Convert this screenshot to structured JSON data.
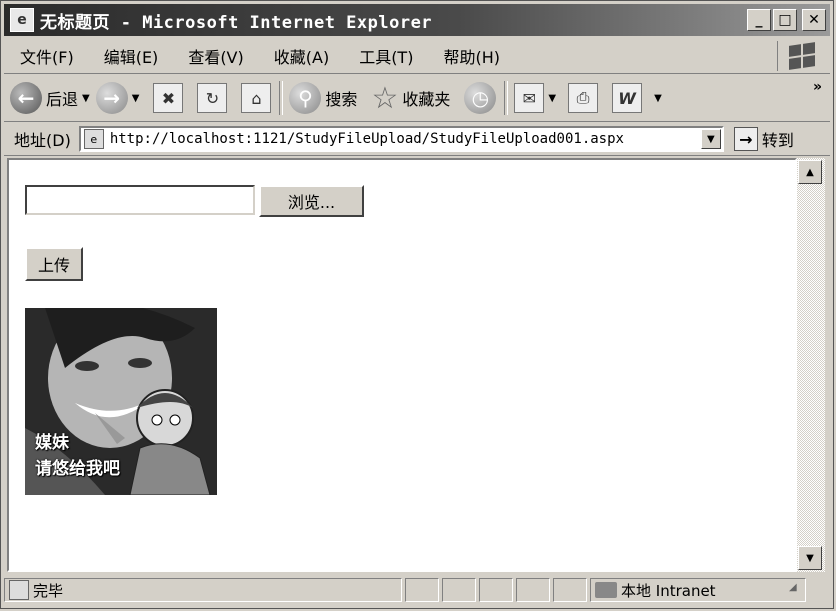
{
  "window": {
    "title": "无标题页 - Microsoft Internet Explorer",
    "controls": {
      "minimize": "_",
      "maximize": "□",
      "close": "✕"
    }
  },
  "menu": [
    {
      "label": "文件(F)"
    },
    {
      "label": "编辑(E)"
    },
    {
      "label": "查看(V)"
    },
    {
      "label": "收藏(A)"
    },
    {
      "label": "工具(T)"
    },
    {
      "label": "帮助(H)"
    }
  ],
  "toolbar": {
    "back_label": "后退",
    "search_label": "搜索",
    "favorites_label": "收藏夹",
    "more": "»"
  },
  "address": {
    "label": "地址(D)",
    "url": "http://localhost:1121/StudyFileUpload/StudyFileUpload001.aspx",
    "go_label": "转到"
  },
  "page": {
    "browse_label": "浏览...",
    "upload_label": "上传",
    "image_caption_line1": "媒妹",
    "image_caption_line2": "请悠给我吧"
  },
  "status": {
    "text": "完毕",
    "zone": "本地 Intranet"
  },
  "icons": {
    "back": "back-arrow-icon",
    "forward": "forward-arrow-icon",
    "stop": "stop-icon",
    "refresh": "refresh-icon",
    "home": "home-icon",
    "search": "search-icon",
    "favorites": "star-icon",
    "history": "history-icon",
    "mail": "mail-icon",
    "print": "print-icon",
    "word": "word-icon"
  }
}
